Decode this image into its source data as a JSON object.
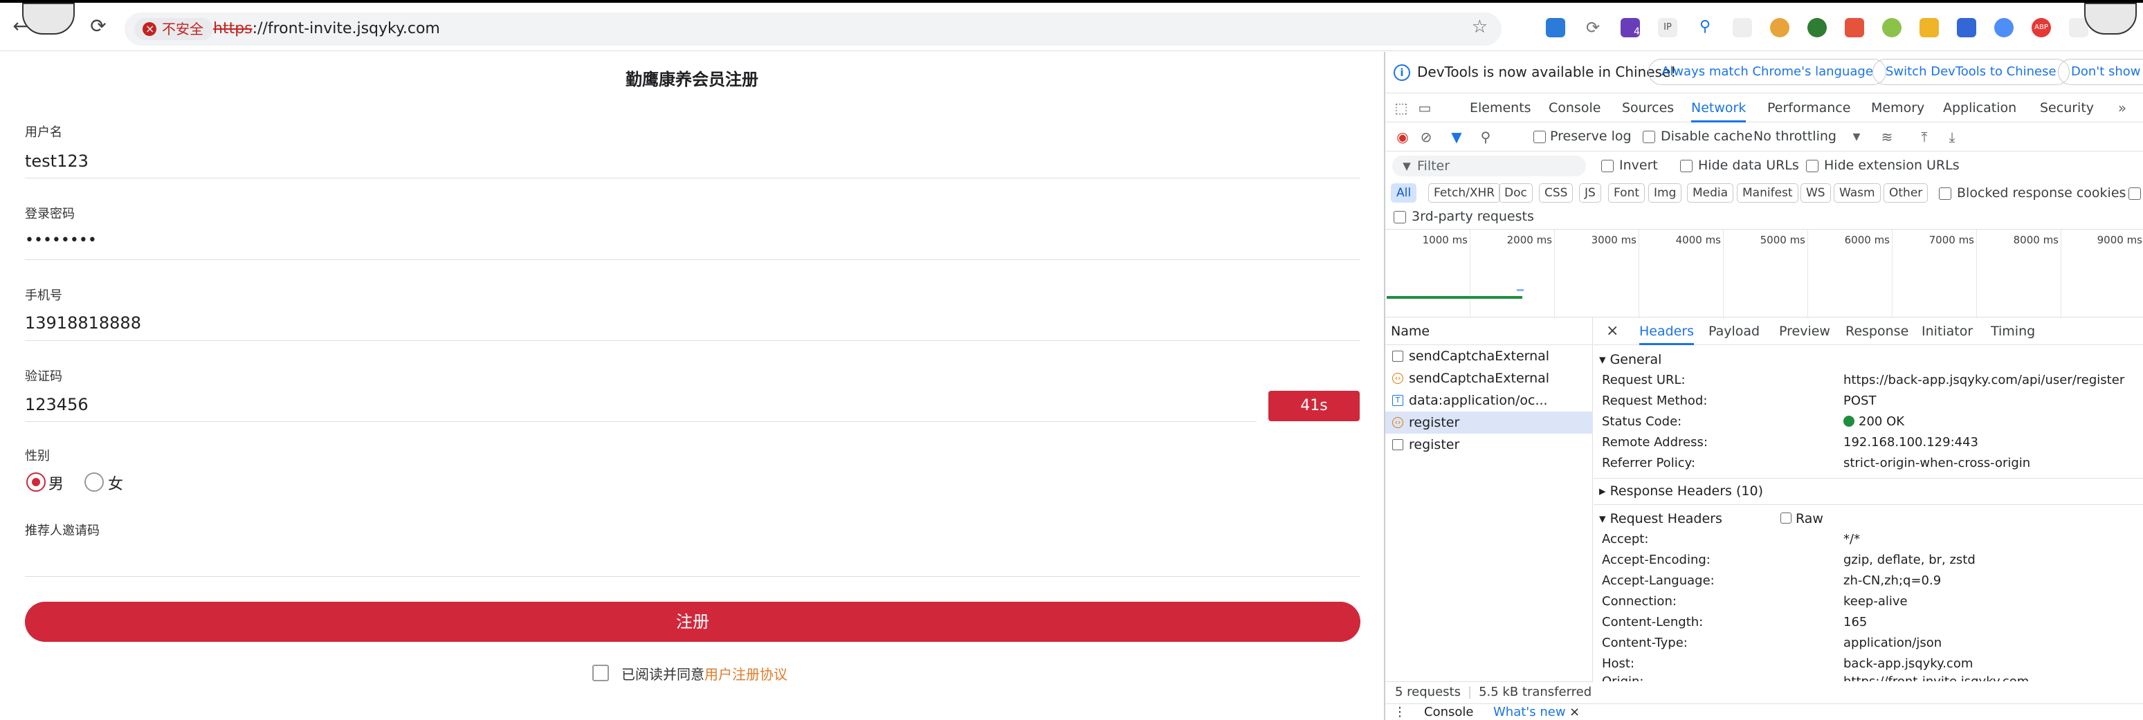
{
  "browser": {
    "insecure_label": "不安全",
    "url_scheme": "https",
    "url_rest": "://front-invite.jsqyky.com",
    "ext_badge": "4"
  },
  "form": {
    "title": "勤鹰康养会员注册",
    "username_label": "用户名",
    "username_value": "test123",
    "password_label": "登录密码",
    "password_value": "••••••••",
    "phone_label": "手机号",
    "phone_value": "13918818888",
    "code_label": "验证码",
    "code_value": "123456",
    "code_timer": "41s",
    "gender_label": "性别",
    "gender_male": "男",
    "gender_female": "女",
    "referral_label": "推荐人邀请码",
    "submit_label": "注册",
    "agree_text": "已阅读并同意",
    "agree_link": "用户注册协议"
  },
  "devtools": {
    "info_text": "DevTools is now available in Chinese!",
    "pill_match": "Always match Chrome's language",
    "pill_switch": "Switch DevTools to Chinese",
    "pill_dont": "Don't show again",
    "tabs": [
      "Elements",
      "Console",
      "Sources",
      "Network",
      "Performance",
      "Memory",
      "Application",
      "Security"
    ],
    "preserve_log": "Preserve log",
    "disable_cache": "Disable cache",
    "throttling": "No throttling",
    "filter_placeholder": "Filter",
    "invert": "Invert",
    "hide_data_urls": "Hide data URLs",
    "hide_ext_urls": "Hide extension URLs",
    "types": [
      "All",
      "Fetch/XHR",
      "Doc",
      "CSS",
      "JS",
      "Font",
      "Img",
      "Media",
      "Manifest",
      "WS",
      "Wasm",
      "Other"
    ],
    "blocked_cookies": "Blocked response cookies",
    "third_party": "3rd-party requests",
    "ticks": [
      "1000 ms",
      "2000 ms",
      "3000 ms",
      "4000 ms",
      "5000 ms",
      "6000 ms",
      "7000 ms",
      "8000 ms",
      "9000 ms"
    ],
    "name_header": "Name",
    "requests": [
      "sendCaptchaExternal",
      "sendCaptchaExternal",
      "data:application/oc...",
      "register",
      "register"
    ],
    "detail_tabs": [
      "Headers",
      "Payload",
      "Preview",
      "Response",
      "Initiator",
      "Timing"
    ],
    "general_title": "General",
    "general": [
      {
        "k": "Request URL:",
        "v": "https://back-app.jsqyky.com/api/user/register"
      },
      {
        "k": "Request Method:",
        "v": "POST"
      },
      {
        "k": "Status Code:",
        "v": "200 OK"
      },
      {
        "k": "Remote Address:",
        "v": "192.168.100.129:443"
      },
      {
        "k": "Referrer Policy:",
        "v": "strict-origin-when-cross-origin"
      }
    ],
    "response_headers_title": "Response Headers (10)",
    "request_headers_title": "Request Headers",
    "raw_label": "Raw",
    "request_headers": [
      {
        "k": "Accept:",
        "v": "*/*"
      },
      {
        "k": "Accept-Encoding:",
        "v": "gzip, deflate, br, zstd"
      },
      {
        "k": "Accept-Language:",
        "v": "zh-CN,zh;q=0.9"
      },
      {
        "k": "Connection:",
        "v": "keep-alive"
      },
      {
        "k": "Content-Length:",
        "v": "165"
      },
      {
        "k": "Content-Type:",
        "v": "application/json"
      },
      {
        "k": "Host:",
        "v": "back-app.jsqyky.com"
      },
      {
        "k": "Origin:",
        "v": "https://front-invite.jsqyky.com"
      }
    ],
    "status_requests": "5 requests",
    "status_transferred": "5.5 kB transferred",
    "drawer_console": "Console",
    "drawer_whatsnew": "What's new"
  }
}
